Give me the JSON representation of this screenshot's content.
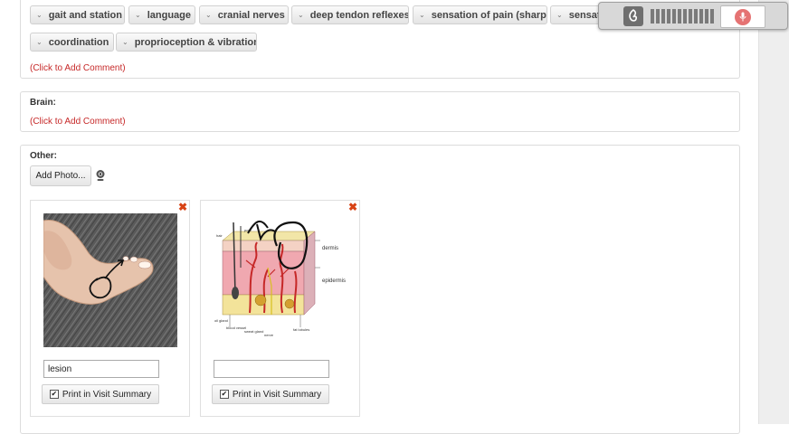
{
  "exam_pills_row1": [
    "gait and station",
    "language",
    "cranial nerves",
    "deep tendon reflexes",
    "sensation of pain (sharp)",
    "sensation of touch (dull)"
  ],
  "exam_pills_row2": [
    "coordination",
    "proprioception & vibration"
  ],
  "comment_link": "(Click to Add Comment)",
  "brain": {
    "heading": "Brain:",
    "comment": "(Click to Add Comment)"
  },
  "other": {
    "heading": "Other:",
    "add_photo_label": "Add Photo...",
    "photos": [
      {
        "caption": "lesion",
        "print_label": "Print in Visit Summary",
        "print_checked": true
      },
      {
        "caption": "",
        "print_label": "Print in Visit Summary",
        "print_checked": true
      }
    ]
  },
  "skin_diagram_labels": {
    "hair": "hair",
    "pore": "pore",
    "dermis": "dermis",
    "epidermis": "epidermis",
    "oil_gland": "oil gland",
    "blood_vessel": "blood vessel",
    "sweat_gland": "sweat gland",
    "nerve": "nerve",
    "fat_lobules": "fat lobules"
  },
  "icons": {
    "chevron": "chevron-down-icon",
    "close": "close-icon",
    "webcam": "webcam-icon",
    "microphone": "microphone-icon",
    "dragon": "dragon-logo-icon"
  },
  "colors": {
    "comment_red": "#c62828",
    "close_orange": "#d84315",
    "mic_red": "#e57373"
  }
}
